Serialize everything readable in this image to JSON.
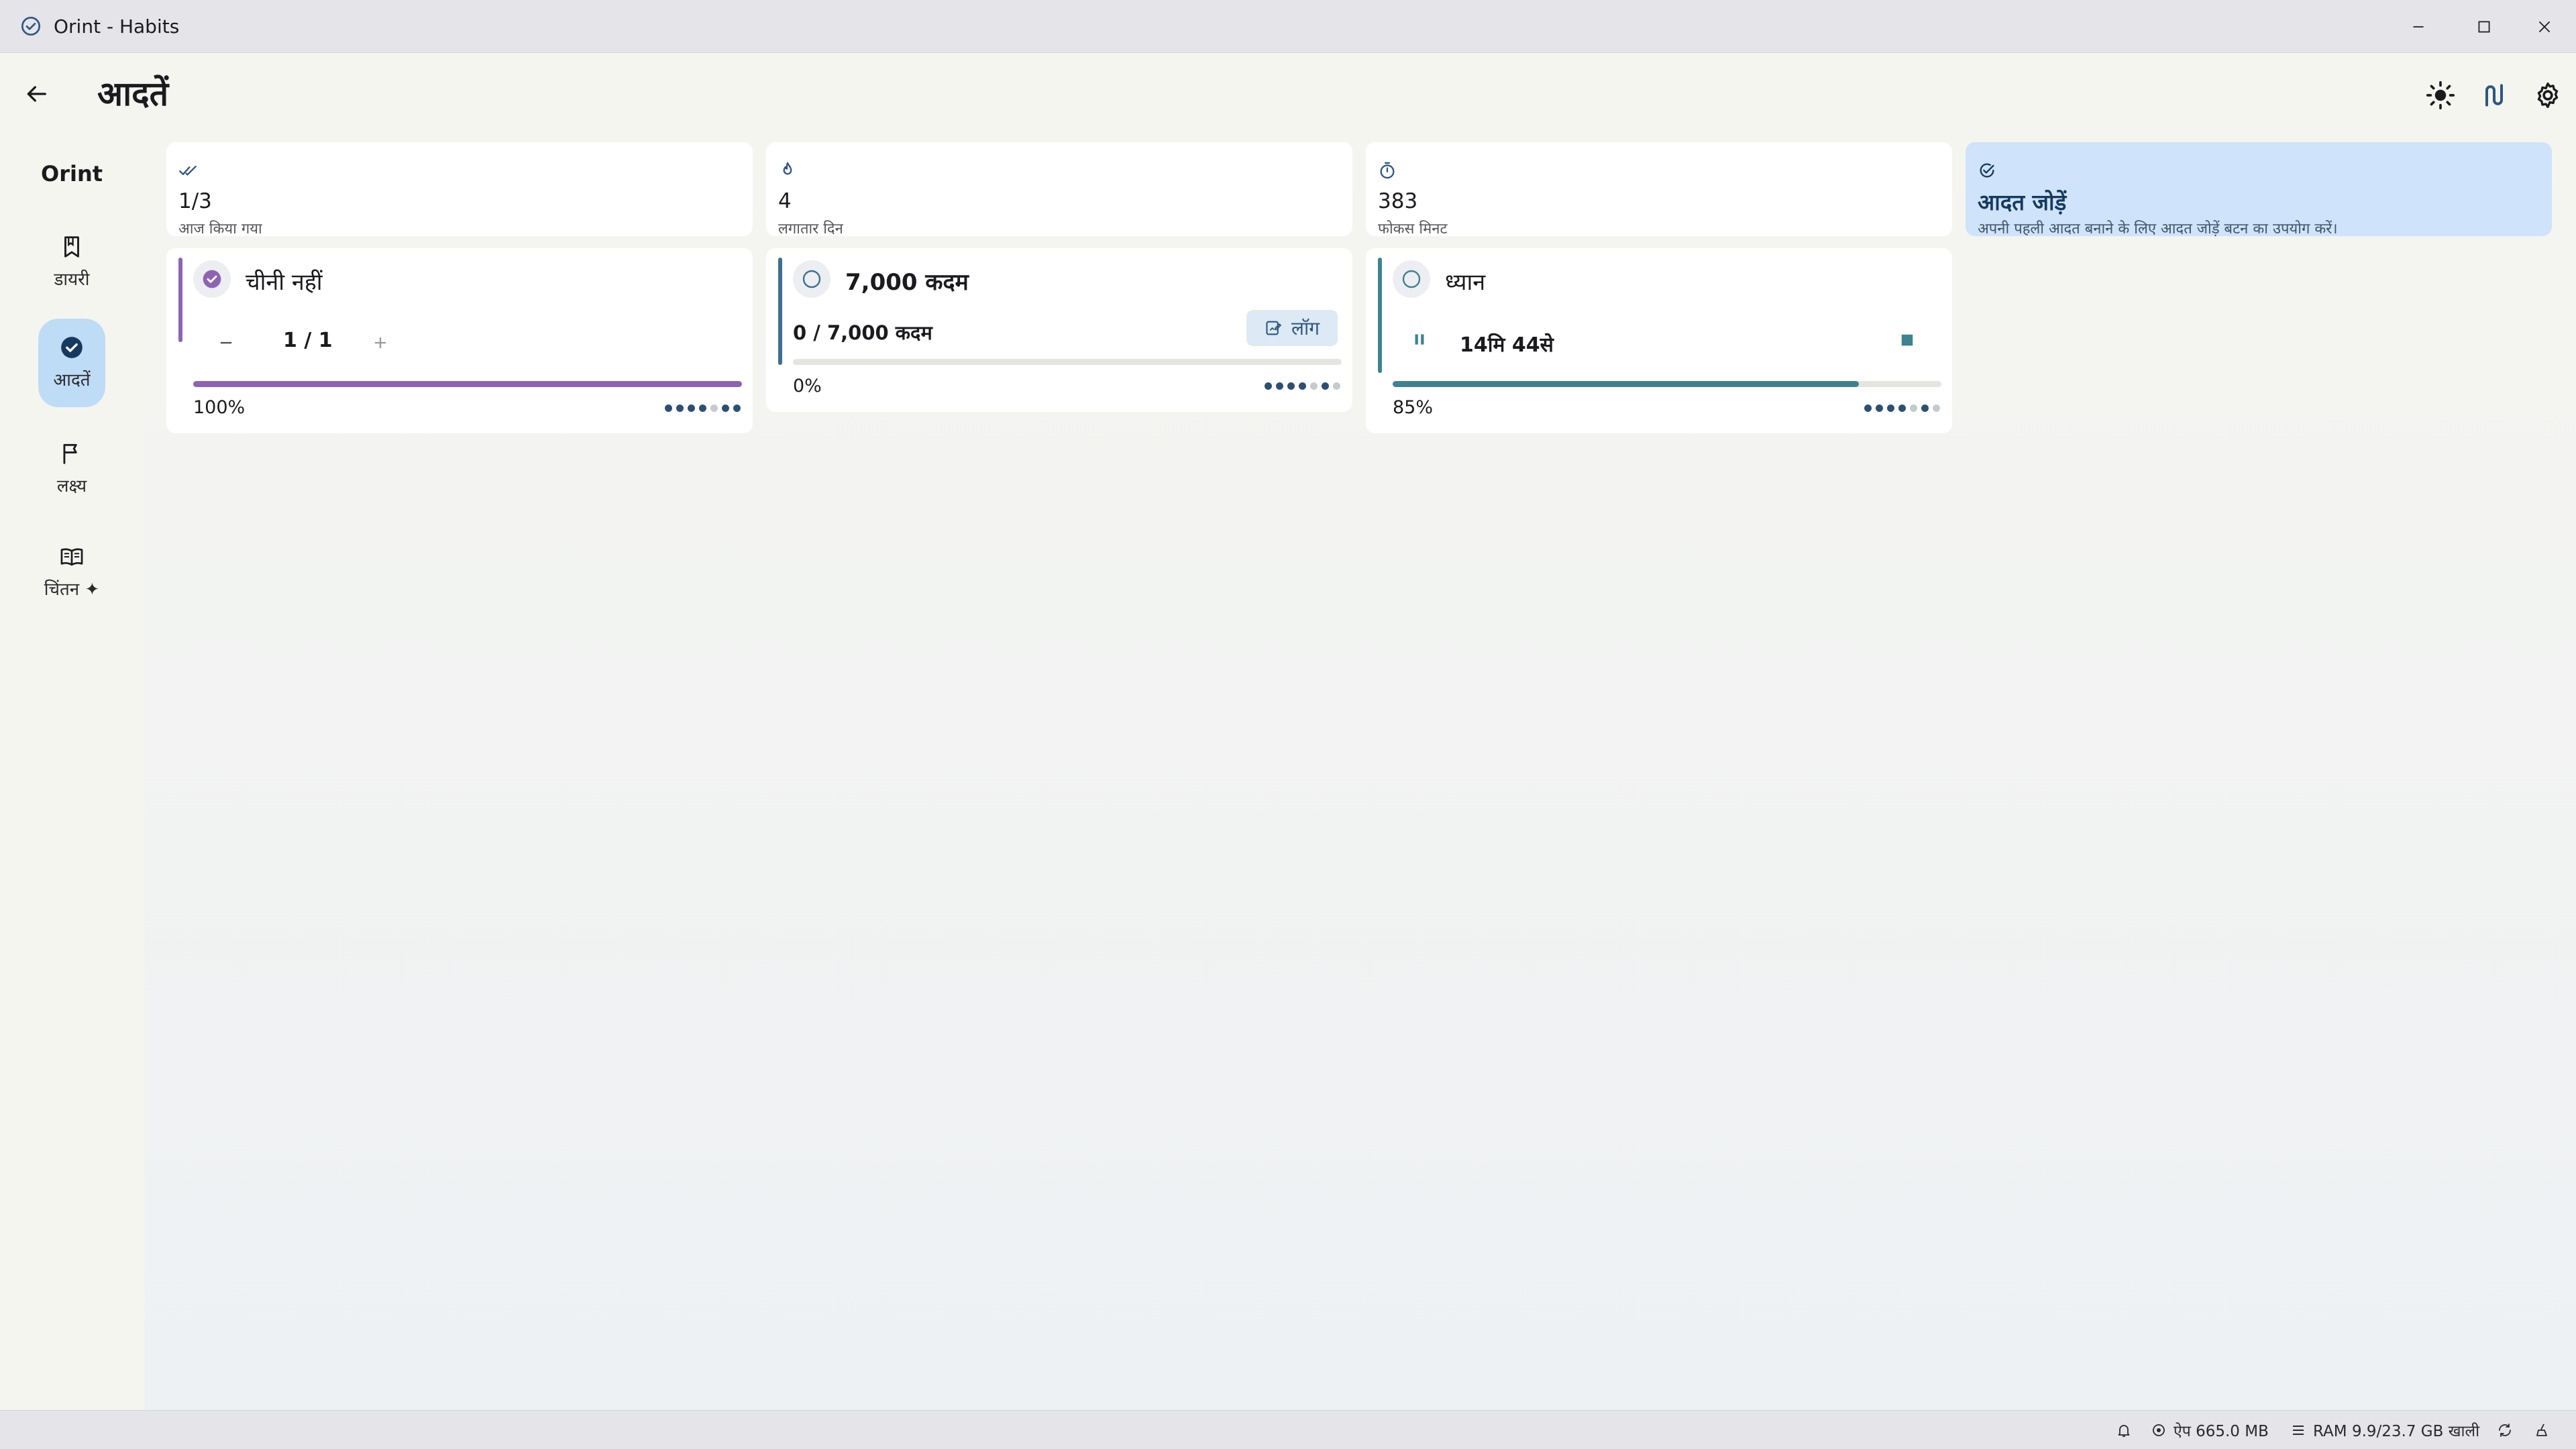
{
  "window": {
    "title": "Orint - Habits",
    "icons": {
      "app": "check-circle-icon",
      "minimize": "minimize-icon",
      "maximize": "maximize-icon",
      "close": "close-icon"
    }
  },
  "header": {
    "title": "आदतें",
    "icons": {
      "back": "arrow-left-icon",
      "theme": "sun-icon",
      "route": "route-icon",
      "settings": "gear-icon"
    }
  },
  "sidebar": {
    "brand": "Orint",
    "items": [
      {
        "label": "डायरी",
        "icon": "bookmark-icon",
        "active": false
      },
      {
        "label": "आदतें",
        "icon": "check-circle-icon",
        "active": true
      },
      {
        "label": "लक्ष्य",
        "icon": "flag-icon",
        "active": false
      },
      {
        "label": "चिंतन ✦",
        "icon": "open-book-icon",
        "active": false
      }
    ]
  },
  "stats": [
    {
      "icon": "double-check-icon",
      "value": "1/3",
      "label": "आज किया गया"
    },
    {
      "icon": "flame-icon",
      "value": "4",
      "label": "लगातार दिन"
    },
    {
      "icon": "timer-icon",
      "value": "383",
      "label": "फोकस मिनट"
    }
  ],
  "cta": {
    "icon": "add-task-icon",
    "title": "आदत जोड़ें",
    "text": "अपनी पहली आदत बनाने के लिए आदत जोड़ें बटन का उपयोग करें।"
  },
  "habits": [
    {
      "name": "चीनी नहीं",
      "kind": "counter",
      "done": true,
      "counter": "1 / 1",
      "progress": 1.0,
      "percent": "100%",
      "accent": "#8e63b5",
      "week": [
        1,
        1,
        1,
        1,
        0,
        1,
        1
      ]
    },
    {
      "name": "7,000 कदम",
      "kind": "amount",
      "done": false,
      "amount": "0 / 7,000 कदम",
      "log_label": "लॉग",
      "progress": 0.0,
      "percent": "0%",
      "accent": "#3f6f8f",
      "week": [
        1,
        1,
        1,
        1,
        0,
        1,
        0
      ]
    },
    {
      "name": "ध्यान",
      "kind": "timer",
      "done": false,
      "timer": "14मि 44से",
      "progress": 0.85,
      "percent": "85%",
      "accent": "#3e8390",
      "week": [
        1,
        1,
        1,
        1,
        0,
        1,
        0
      ]
    }
  ],
  "colors": {
    "primary": "#2d5780",
    "active_nav": "#bfdcf6",
    "cta_bg": "#cfe3fa",
    "done_purple": "#8e63b5",
    "teal": "#3e8390",
    "dot_on": "#2d4f74",
    "dot_off": "#c6c9cf"
  },
  "statusbar": {
    "app_mem": "ऐप 665.0 MB",
    "ram": "RAM 9.9/23.7 GB खाली",
    "icons": [
      "bell-icon",
      "cpu-icon",
      "server-icon",
      "recycle-icon",
      "broom-icon"
    ]
  }
}
